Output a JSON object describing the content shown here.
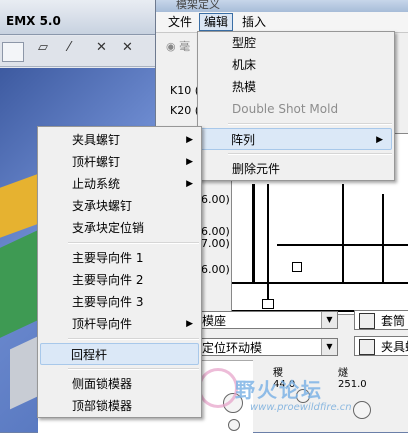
{
  "app": {
    "title_fragment": "EMX 5.0"
  },
  "dialog": {
    "title": "模架定义",
    "menubar": [
      "文件",
      "编辑",
      "插入"
    ],
    "labels": {
      "radio": "毫",
      "k10": "K10 (2",
      "k20": "K20 (5",
      "dim1": "6.00)",
      "dim2": "6.00)",
      "dim3": "7.00)",
      "dim4": "6.00)"
    },
    "combos": [
      {
        "value": "模座"
      },
      {
        "value": "定位环动模"
      }
    ],
    "side_buttons": [
      "套筒",
      "夹具螺"
    ],
    "bottom_readouts": [
      "躺 1",
      "稷 44.0",
      "燧 251.0"
    ]
  },
  "edit_menu": {
    "items": [
      {
        "label": "型腔",
        "disabled": false
      },
      {
        "label": "机床",
        "disabled": false
      },
      {
        "label": "热模",
        "disabled": false
      },
      {
        "label": "Double Shot Mold",
        "disabled": true
      },
      {
        "label": "阵列",
        "submenu": true,
        "highlighted": true
      },
      {
        "label": "删除元件",
        "disabled": false
      }
    ]
  },
  "context_menu": {
    "items": [
      {
        "label": "夹具螺钉",
        "submenu": true
      },
      {
        "label": "顶杆螺钉",
        "submenu": true
      },
      {
        "label": "止动系统",
        "submenu": true
      },
      {
        "label": "支承块螺钉",
        "submenu": false
      },
      {
        "label": "支承块定位销",
        "submenu": false
      },
      {
        "label": "主要导向件 1",
        "submenu": false
      },
      {
        "label": "主要导向件 2",
        "submenu": false
      },
      {
        "label": "主要导向件 3",
        "submenu": false
      },
      {
        "label": "顶杆导向件",
        "submenu": true
      },
      {
        "label": "回程杆",
        "submenu": false,
        "highlighted": true
      },
      {
        "label": "侧面锁模器",
        "submenu": false
      },
      {
        "label": "顶部锁模器",
        "submenu": false
      }
    ]
  },
  "watermark": {
    "text": "野火论坛",
    "url": "www.proewildfire.cn"
  }
}
